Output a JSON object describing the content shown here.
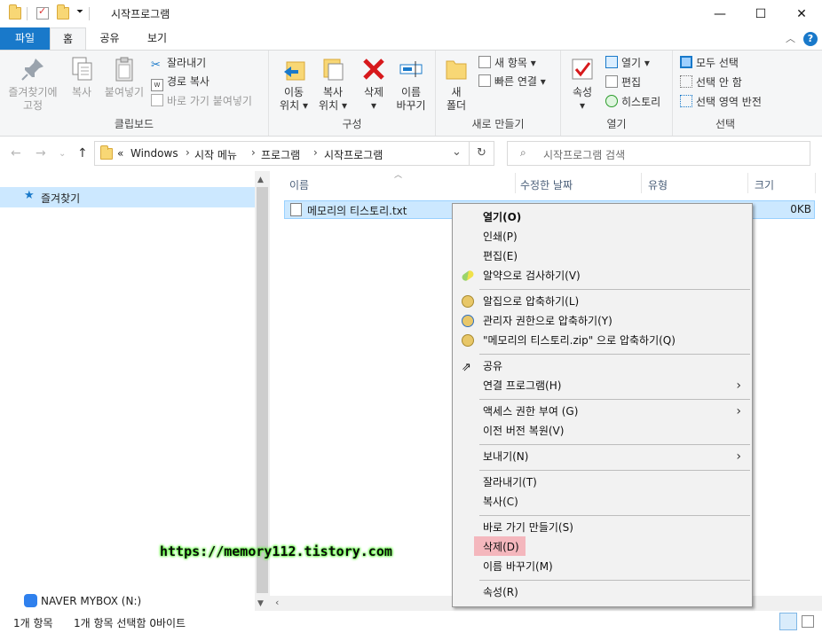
{
  "window": {
    "title": "시작프로그램",
    "minimize": "—",
    "maximize": "☐",
    "close": "✕"
  },
  "tabs": [
    {
      "label": "파일"
    },
    {
      "label": "홈"
    },
    {
      "label": "공유"
    },
    {
      "label": "보기"
    }
  ],
  "help": "?",
  "ribbon": {
    "clipboard": {
      "label": "클립보드",
      "pin_line1": "즐겨찾기에",
      "pin_line2": "고정",
      "copy": "복사",
      "paste": "붙여넣기",
      "cut": "잘라내기",
      "copy_path": "경로 복사",
      "paste_shortcut": "바로 가기 붙여넣기"
    },
    "organize": {
      "label": "구성",
      "move_line1": "이동",
      "move_line2": "위치",
      "copyto_line1": "복사",
      "copyto_line2": "위치",
      "delete": "삭제",
      "rename_line1": "이름",
      "rename_line2": "바꾸기"
    },
    "new": {
      "label": "새로 만들기",
      "folder_line1": "새",
      "folder_line2": "폴더",
      "new_item": "새 항목",
      "easy_access": "빠른 연결"
    },
    "open": {
      "label": "열기",
      "properties": "속성",
      "open": "열기",
      "edit": "편집",
      "history": "히스토리"
    },
    "select": {
      "label": "선택",
      "select_all": "모두 선택",
      "select_none": "선택 안 함",
      "invert": "선택 영역 반전"
    }
  },
  "address": {
    "prefix": "«",
    "crumbs": [
      "Windows",
      "시작 메뉴",
      "프로그램",
      "시작프로그램"
    ],
    "search_placeholder": "시작프로그램 검색"
  },
  "nav_pane": {
    "favorites": "즐겨찾기",
    "mybox": "NAVER MYBOX (N:)"
  },
  "columns": {
    "name": "이름",
    "modified": "수정한 날짜",
    "type": "유형",
    "size": "크기"
  },
  "files": [
    {
      "name": "메모리의 티스토리.txt",
      "size": "0KB"
    }
  ],
  "context_menu": {
    "open": "열기(O)",
    "print": "인쇄(P)",
    "edit": "편집(E)",
    "scan": "알약으로 검사하기(V)",
    "alzip": "알집으로 압축하기(L)",
    "alzip_admin": "관리자 권한으로 압축하기(Y)",
    "alzip_named": "\"메모리의 티스토리.zip\" 으로 압축하기(Q)",
    "share": "공유",
    "open_with": "연결 프로그램(H)",
    "give_access": "액세스 권한 부여 (G)",
    "restore": "이전 버전 복원(V)",
    "send_to": "보내기(N)",
    "cut": "잘라내기(T)",
    "copy": "복사(C)",
    "shortcut": "바로 가기 만들기(S)",
    "delete": "삭제(D)",
    "rename": "이름 바꾸기(M)",
    "properties": "속성(R)"
  },
  "status": {
    "count": "1개 항목",
    "selected": "1개 항목 선택함 0바이트"
  },
  "watermark": "https://memory112.tistory.com",
  "colors": {
    "accent": "#1979ca",
    "selection": "#cce8ff",
    "delete_highlight": "#f4b7bd"
  }
}
